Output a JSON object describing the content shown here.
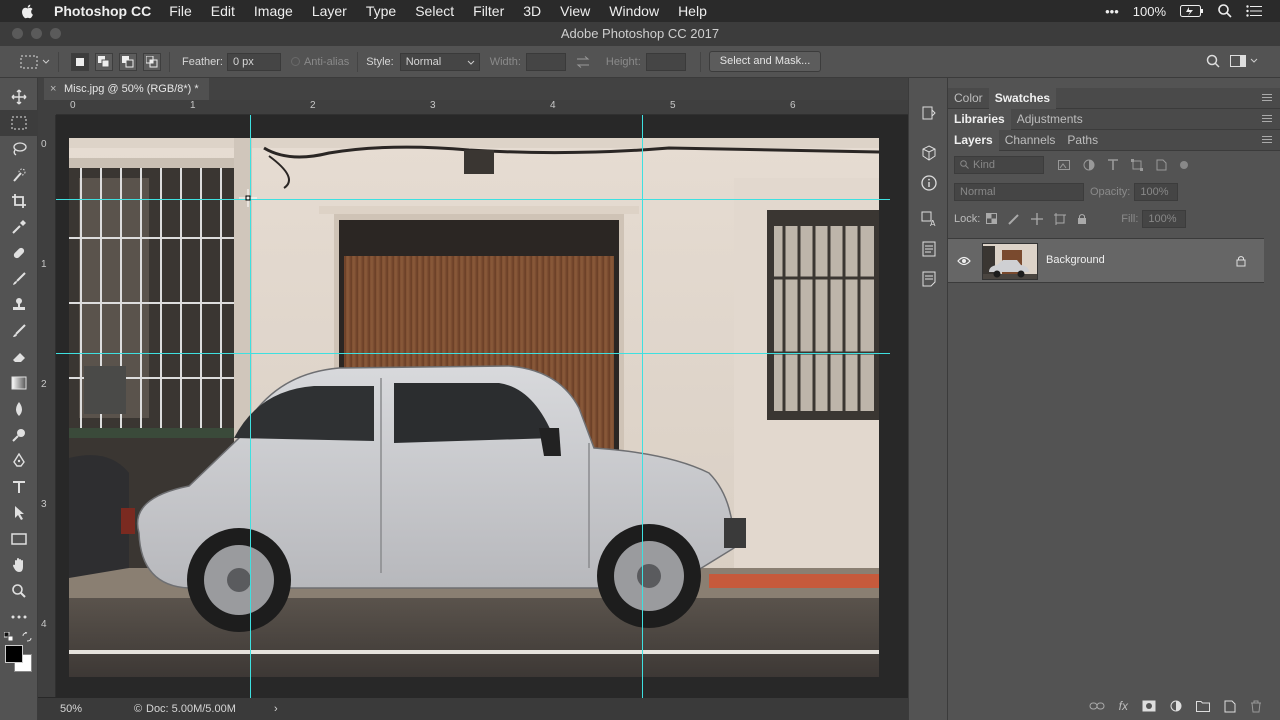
{
  "menubar": {
    "app": "Photoshop CC",
    "items": [
      "File",
      "Edit",
      "Image",
      "Layer",
      "Type",
      "Select",
      "Filter",
      "3D",
      "View",
      "Window",
      "Help"
    ],
    "battery": "100%",
    "dots": "•••"
  },
  "window": {
    "title": "Adobe Photoshop CC 2017"
  },
  "options": {
    "feather_label": "Feather:",
    "feather_value": "0 px",
    "antialias_label": "Anti-alias",
    "style_label": "Style:",
    "style_value": "Normal",
    "width_label": "Width:",
    "height_label": "Height:",
    "select_mask_button": "Select and Mask..."
  },
  "document": {
    "tab_title": "Misc.jpg @ 50% (RGB/8*) *",
    "zoom": "50%",
    "doc_info": "Doc: 5.00M/5.00M",
    "ruler_top": [
      "0",
      "1",
      "2",
      "3",
      "4",
      "5",
      "6"
    ],
    "ruler_left": [
      "0",
      "1",
      "2",
      "3",
      "4"
    ]
  },
  "panels": {
    "group1_tabs": [
      "Color",
      "Swatches"
    ],
    "group2_tabs": [
      "Libraries",
      "Adjustments"
    ],
    "group3_tabs": [
      "Layers",
      "Channels",
      "Paths"
    ],
    "kind_placeholder": "Kind",
    "blend_mode": "Normal",
    "opacity_label": "Opacity:",
    "opacity_value": "100%",
    "lock_label": "Lock:",
    "fill_label": "Fill:",
    "fill_value": "100%",
    "layer_name": "Background"
  },
  "colors": {
    "guide": "#3ee0e0",
    "ui_bg": "#535353",
    "canvas_bg": "#282828"
  }
}
